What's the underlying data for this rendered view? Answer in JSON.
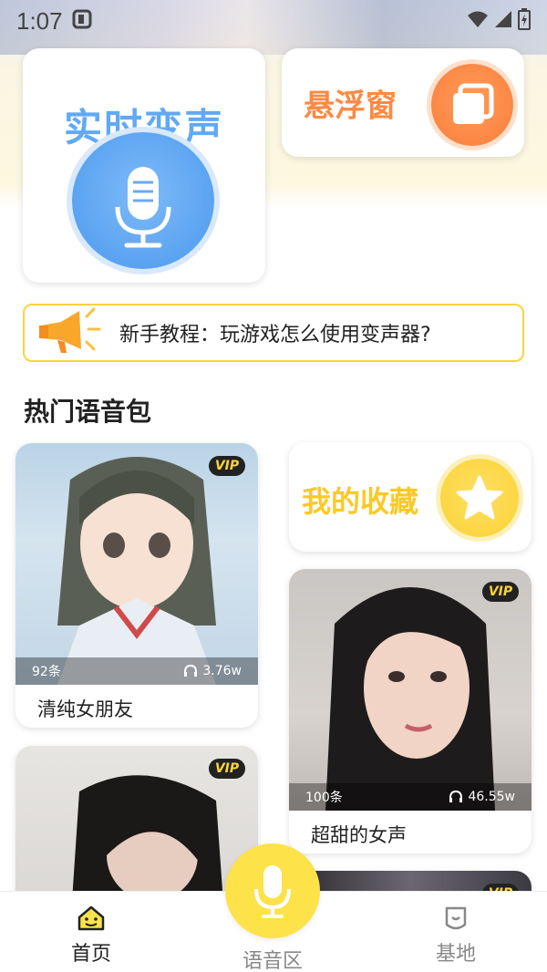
{
  "status_bar": {
    "time": "1:07"
  },
  "realtime_card": {
    "title": "实时变声"
  },
  "floating_card": {
    "title": "悬浮窗"
  },
  "tutorial": {
    "text": "新手教程：玩游戏怎么使用变声器?"
  },
  "section": {
    "title": "热门语音包"
  },
  "favorites_card": {
    "title": "我的收藏"
  },
  "packs": [
    {
      "name": "清纯女朋友",
      "count": "92条",
      "plays": "3.76w",
      "badge": "VIP"
    },
    {
      "name": "超甜的女声",
      "count": "100条",
      "plays": "46.55w",
      "badge": "VIP"
    },
    {
      "badge": "VIP"
    },
    {
      "badge": "VIP"
    }
  ],
  "bottom_nav": {
    "home": "首页",
    "voice_zone": "语音区",
    "base": "基地"
  },
  "colors": {
    "accent_blue": "#62a9f4",
    "accent_orange": "#fb8a44",
    "accent_yellow": "#fbd43b"
  }
}
